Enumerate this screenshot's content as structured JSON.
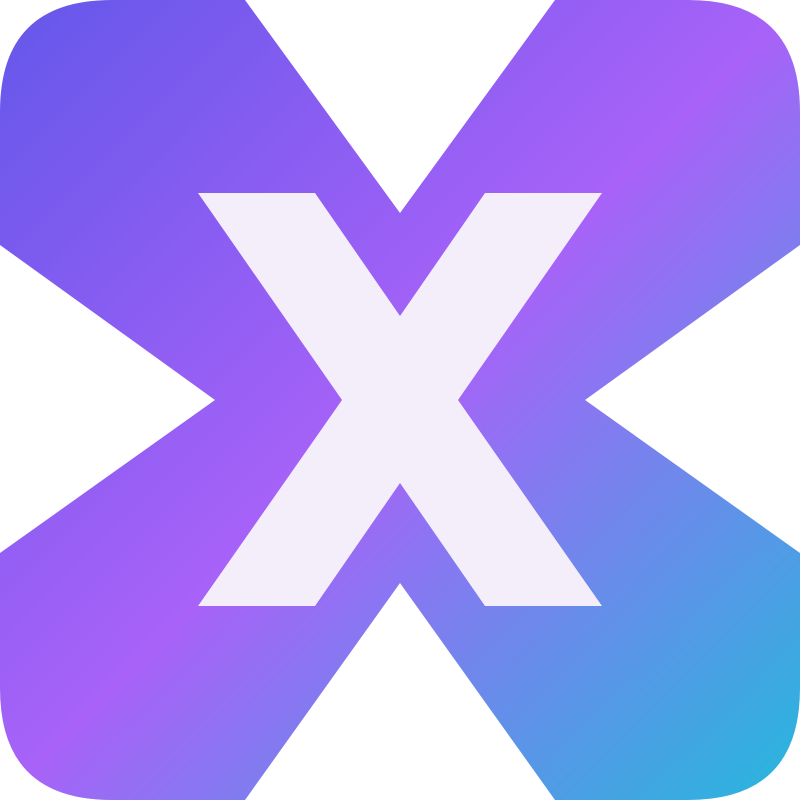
{
  "logo": {
    "name": "x-app-icon",
    "glyph": "X",
    "colors": {
      "gradient_start": "#6457EA",
      "gradient_mid": "#A862F8",
      "gradient_end": "#25B8DC",
      "letter_fill": "#F4EEFB",
      "background": "#FFFFFF"
    }
  }
}
